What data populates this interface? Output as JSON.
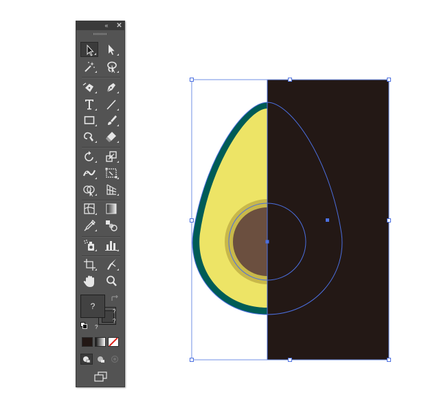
{
  "tools_panel": {
    "collapse_glyph": "«",
    "close_glyph": "✕",
    "tools": [
      {
        "name": "selection-tool",
        "icon": "arrow-pointer-icon"
      },
      {
        "name": "direct-selection-tool",
        "icon": "white-arrow-icon"
      },
      {
        "name": "magic-wand-tool",
        "icon": "magic-wand-icon"
      },
      {
        "name": "lasso-tool",
        "icon": "lasso-icon"
      },
      {
        "name": "curvature-tool",
        "icon": "curvature-pen-icon"
      },
      {
        "name": "pen-tool",
        "icon": "pen-icon"
      },
      {
        "name": "type-tool",
        "icon": "type-icon"
      },
      {
        "name": "line-segment-tool",
        "icon": "line-icon"
      },
      {
        "name": "rectangle-tool",
        "icon": "rectangle-icon"
      },
      {
        "name": "paintbrush-tool",
        "icon": "paintbrush-icon"
      },
      {
        "name": "shaper-tool",
        "icon": "shaper-icon"
      },
      {
        "name": "eraser-tool",
        "icon": "eraser-icon"
      },
      {
        "name": "rotate-tool",
        "icon": "rotate-icon"
      },
      {
        "name": "scale-tool",
        "icon": "scale-icon"
      },
      {
        "name": "width-tool",
        "icon": "width-icon"
      },
      {
        "name": "free-transform-tool",
        "icon": "free-transform-icon"
      },
      {
        "name": "shape-builder-tool",
        "icon": "shape-builder-icon"
      },
      {
        "name": "perspective-grid-tool",
        "icon": "perspective-grid-icon"
      },
      {
        "name": "mesh-tool",
        "icon": "mesh-icon"
      },
      {
        "name": "gradient-tool",
        "icon": "gradient-icon"
      },
      {
        "name": "eyedropper-tool",
        "icon": "eyedropper-icon"
      },
      {
        "name": "blend-tool",
        "icon": "blend-icon"
      },
      {
        "name": "symbol-sprayer-tool",
        "icon": "symbol-sprayer-icon"
      },
      {
        "name": "column-graph-tool",
        "icon": "column-graph-icon"
      },
      {
        "name": "artboard-tool",
        "icon": "artboard-icon"
      },
      {
        "name": "slice-tool",
        "icon": "slice-icon"
      },
      {
        "name": "hand-tool",
        "icon": "hand-icon"
      },
      {
        "name": "zoom-tool",
        "icon": "zoom-icon"
      }
    ],
    "fill_label": "?",
    "stroke_label": "?",
    "mixed_label_a": "?",
    "mixed_label_b": "?"
  },
  "colors": {
    "panel_bg": "#535353",
    "avocado_skin": "#005c56",
    "avocado_flesh": "#ede466",
    "pit_ring": "#c8b84a",
    "pit": "#6b4f3f",
    "dark_rect": "#231815",
    "selection_blue": "#4b6fe0"
  }
}
